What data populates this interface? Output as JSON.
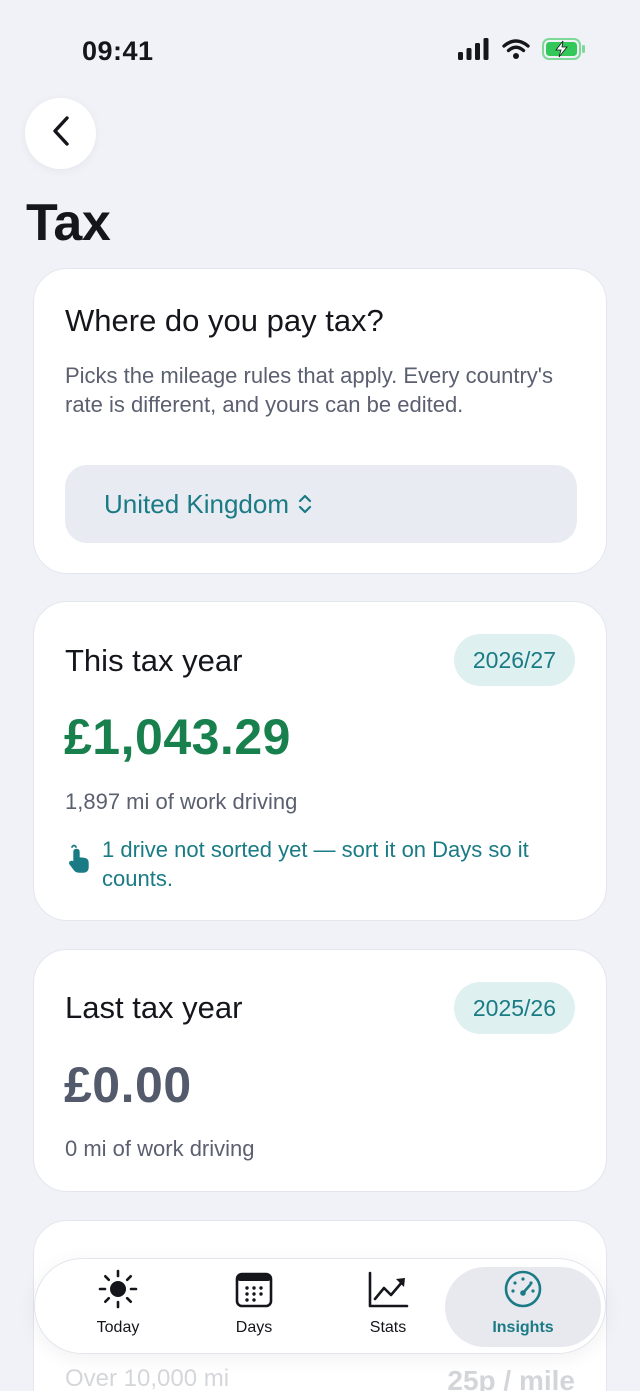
{
  "status": {
    "time": "09:41"
  },
  "header": {
    "title": "Tax"
  },
  "country_card": {
    "heading": "Where do you pay tax?",
    "description": "Picks the mileage rules that apply. Every country's rate is different, and yours can be edited.",
    "selected_country": "United Kingdom"
  },
  "this_year": {
    "heading": "This tax year",
    "period": "2026/27",
    "amount": "£1,043.29",
    "miles": "1,897 mi of work driving",
    "notice": "1 drive not sorted yet — sort it on Days so it counts."
  },
  "last_year": {
    "heading": "Last tax year",
    "period": "2025/26",
    "amount": "£0.00",
    "miles": "0 mi of work driving"
  },
  "rate_card": {
    "threshold": "Over 10,000 mi",
    "rate": "25p / mile"
  },
  "tabs": [
    {
      "label": "Today",
      "icon": "sun-icon"
    },
    {
      "label": "Days",
      "icon": "calendar-icon"
    },
    {
      "label": "Stats",
      "icon": "chart-icon"
    },
    {
      "label": "Insights",
      "icon": "gauge-icon",
      "active": true
    }
  ],
  "colors": {
    "accent": "#1a7b85",
    "money_green": "#17804d",
    "battery_green": "#34c759",
    "background": "#f1f2f8"
  }
}
